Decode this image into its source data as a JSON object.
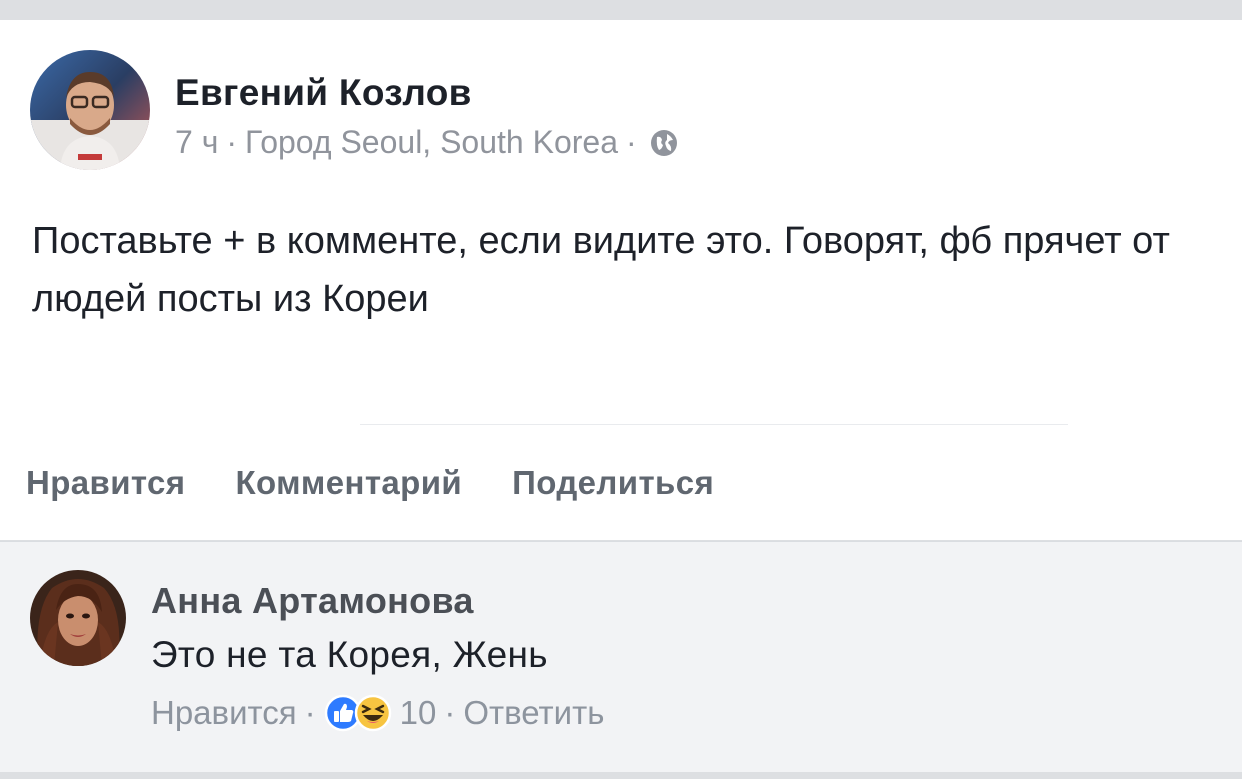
{
  "post": {
    "author": "Евгений Козлов",
    "time": "7 ч",
    "location": "Город Seoul, South Korea",
    "privacy_icon": "globe-icon",
    "text": "Поставьте + в комменте, если видите это. Говорят, фб прячет от людей посты из Кореи",
    "actions": {
      "like": "Нравится",
      "comment": "Комментарий",
      "share": "Поделиться"
    }
  },
  "comment": {
    "author": "Анна Артамонова",
    "text": "Это не та Корея, Жень",
    "like_label": "Нравится",
    "reactions": [
      "like-reaction-icon",
      "haha-reaction-icon"
    ],
    "reaction_count": "10",
    "reply_label": "Ответить"
  },
  "colors": {
    "background": "#dddfe2",
    "card": "#ffffff",
    "comment_bg": "#f2f3f5",
    "like_blue": "#2e7bff",
    "haha_yellow": "#f7c441"
  }
}
